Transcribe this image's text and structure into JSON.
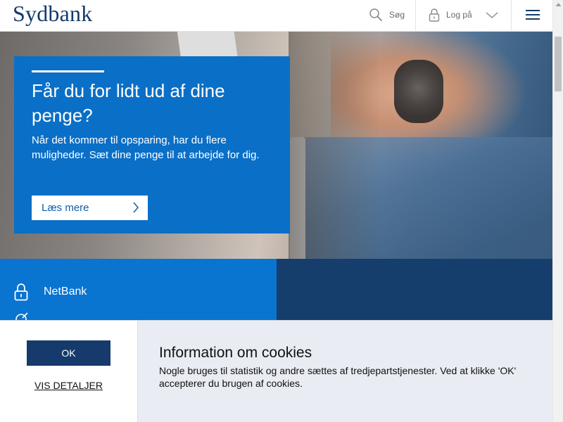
{
  "header": {
    "logo": "Sydbank",
    "search_label": "Søg",
    "login_label": "Log på",
    "icons": [
      "search-icon",
      "lock-icon",
      "chevron-down-icon",
      "hamburger-menu-icon"
    ]
  },
  "hero": {
    "title": "Får du for lidt ud af dine penge?",
    "text": "Når det kommer til opsparing, har du flere muligheder. Sæt dine penge til at arbejde for dig.",
    "button_label": "Læs mere"
  },
  "quicklinks": {
    "items": [
      {
        "label": "NetBank",
        "icon": "lock-icon"
      }
    ]
  },
  "cookie": {
    "ok_label": "OK",
    "details_label": "VIS DETALJER",
    "title": "Information om cookies",
    "text": "Nogle bruges til statistik og andre sættes af tredjepartstjenester. Ved at klikke 'OK' accepterer du brugen af cookies."
  },
  "colors": {
    "brand_navy": "#153a6b",
    "hero_blue": "#0a6fc7",
    "panel_blue": "#0a74d1",
    "panel_navy": "#163e6d",
    "cookie_bg": "#e9ecf2"
  }
}
